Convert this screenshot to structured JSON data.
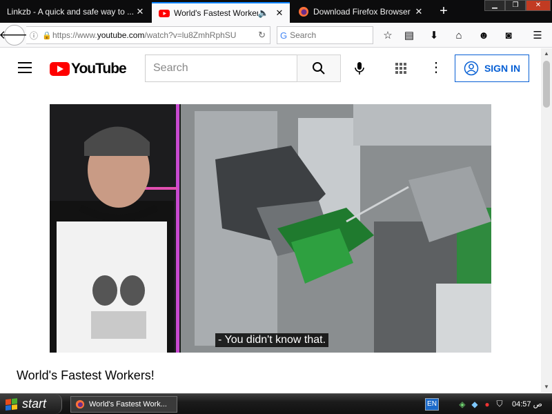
{
  "browser": {
    "tabs": [
      {
        "title": "Linkzb - A quick and safe way to ...",
        "active": false
      },
      {
        "title": "World's Fastest Workers!...",
        "active": true,
        "audio": true
      },
      {
        "title": "Download Firefox Browser – ...",
        "active": false
      }
    ],
    "new_tab_label": "+",
    "url_prefix": "https://www.",
    "url_domain": "youtube.com",
    "url_path": "/watch?v=lu8ZmhRphSU",
    "search_placeholder": "Search",
    "accent_color": "#0a84ff"
  },
  "youtube": {
    "logo_text": "YouTube",
    "search_placeholder": "Search",
    "signin_label": "SIGN IN",
    "brand_color": "#ff0000",
    "link_color": "#065fd4"
  },
  "video": {
    "subtitle": "- You didn't know that.",
    "title": "World's Fastest Workers!"
  },
  "taskbar": {
    "start_label": "start",
    "window_button": "World's Fastest Work...",
    "language": "EN",
    "clock": "04:57",
    "clock_suffix": "ص"
  }
}
